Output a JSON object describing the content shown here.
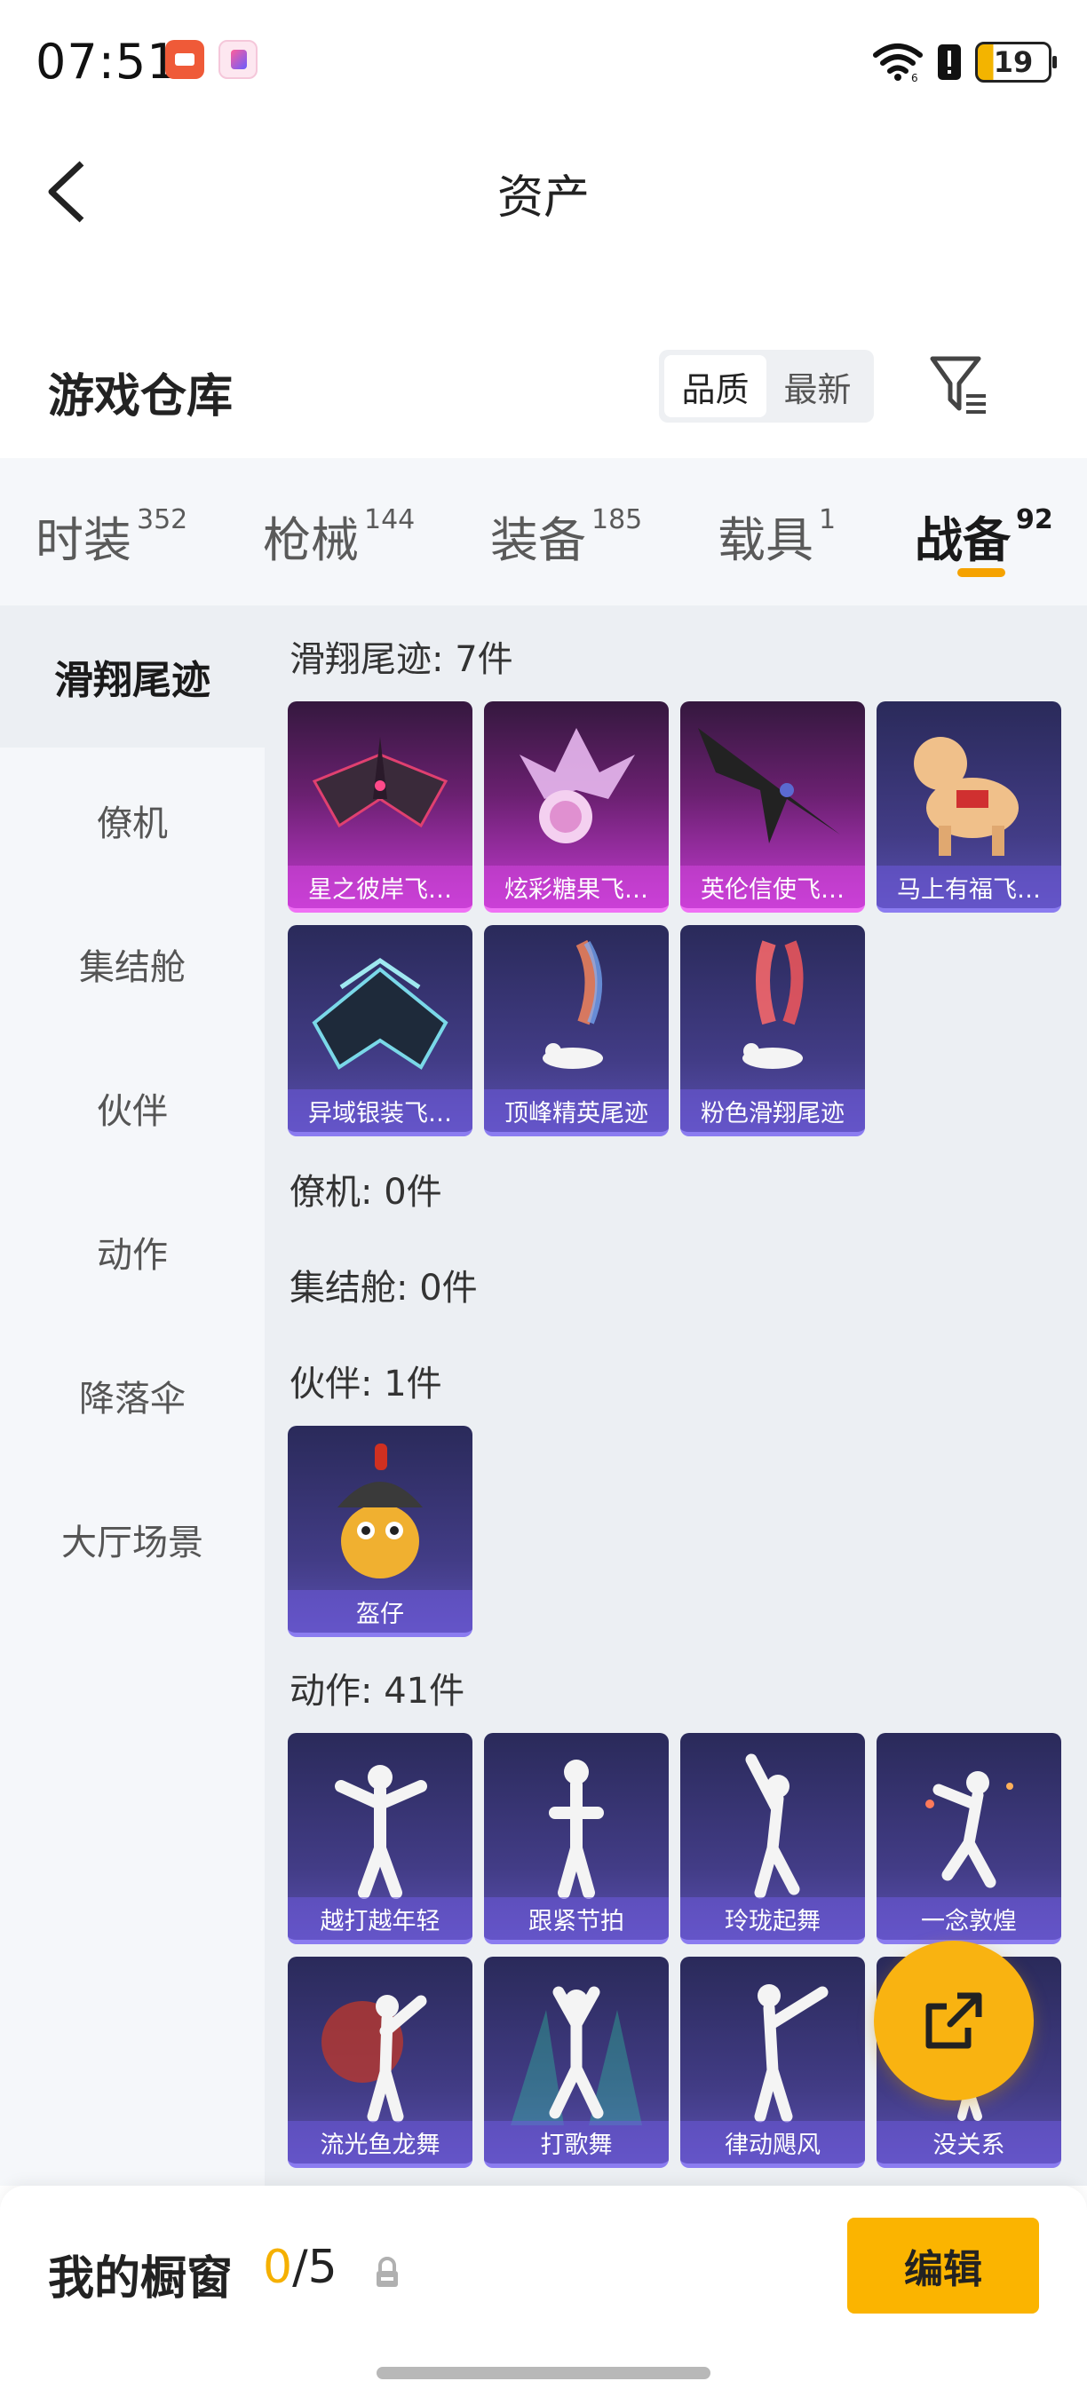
{
  "status_bar": {
    "time": "07:51",
    "battery": "19"
  },
  "header": {
    "title": "资产"
  },
  "warehouse": {
    "title": "游戏仓库",
    "sort_options": [
      "品质",
      "最新"
    ],
    "active_sort": "品质"
  },
  "tabs": [
    {
      "label": "时装",
      "count": "352"
    },
    {
      "label": "枪械",
      "count": "144"
    },
    {
      "label": "装备",
      "count": "185"
    },
    {
      "label": "载具",
      "count": "1"
    },
    {
      "label": "战备",
      "count": "92",
      "active": true
    }
  ],
  "sidebar": {
    "items": [
      "滑翔尾迹",
      "僚机",
      "集结舱",
      "伙伴",
      "动作",
      "降落伞",
      "大厅场景"
    ],
    "active": "滑翔尾迹"
  },
  "groups": {
    "glide_trails": {
      "title": "滑翔尾迹: 7件",
      "items": [
        "星之彼岸飞…",
        "炫彩糖果飞…",
        "英伦信使飞…",
        "马上有福飞…",
        "异域银装飞…",
        "顶峰精英尾迹",
        "粉色滑翔尾迹"
      ]
    },
    "wingman": {
      "title": "僚机: 0件"
    },
    "rally_pod": {
      "title": "集结舱: 0件"
    },
    "companion": {
      "title": "伙伴: 1件",
      "items": [
        "盔仔"
      ]
    },
    "emotes": {
      "title": "动作: 41件",
      "items": [
        "越打越年轻",
        "跟紧节拍",
        "玲珑起舞",
        "一念敦煌",
        "流光鱼龙舞",
        "打歌舞",
        "律动飓风",
        "没关系"
      ]
    }
  },
  "showcase": {
    "title": "我的橱窗",
    "count": "0",
    "total": "/5",
    "edit_label": "编辑"
  },
  "colors": {
    "accent": "#fbb400",
    "tab_underline": "#f5a200",
    "card_pink": "#c23ad0",
    "card_purple": "#5a50b0"
  }
}
